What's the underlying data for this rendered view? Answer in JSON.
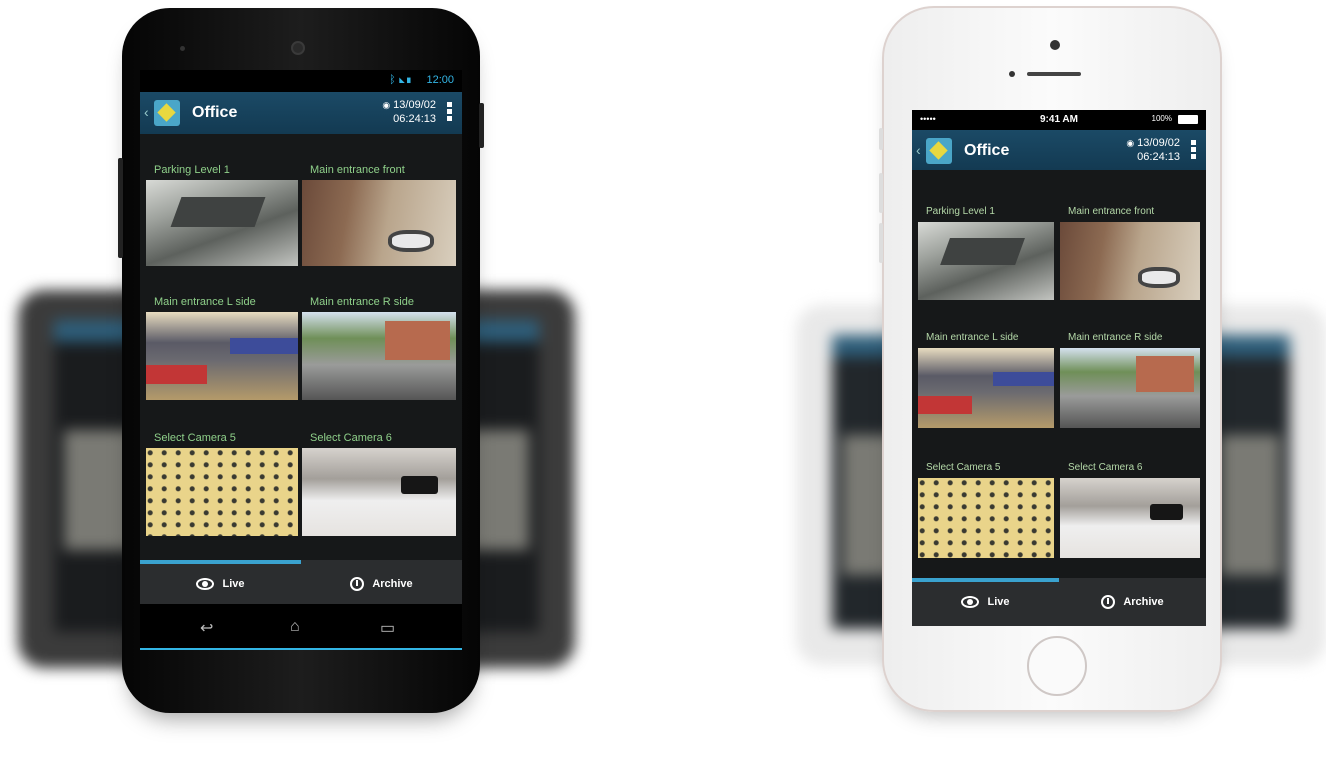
{
  "app": {
    "title": "Office",
    "date": "13/09/02",
    "time": "06:24:13"
  },
  "android": {
    "status_time": "12:00",
    "status_icons": "BT WiFi Signal Battery"
  },
  "ios": {
    "carrier": "••••• ",
    "status_time": "9:41 AM",
    "battery": "100%"
  },
  "cameras": [
    {
      "label": "Parking Level 1",
      "icon": "parking-camera"
    },
    {
      "label": "Main entrance front",
      "icon": "entrance-front-camera"
    },
    {
      "label": "Main entrance L side",
      "icon": "entrance-left-camera"
    },
    {
      "label": "Main entrance R side",
      "icon": "entrance-right-camera"
    },
    {
      "label": "Select Camera 5",
      "icon": "camera-5"
    },
    {
      "label": "Select Camera 6",
      "icon": "camera-6"
    }
  ],
  "tabs": {
    "live": "Live",
    "archive": "Archive",
    "active": "live"
  },
  "colors": {
    "accent": "#3aa2cf",
    "appbar": "#1b4a66",
    "camera_label": "#8fd08a"
  }
}
